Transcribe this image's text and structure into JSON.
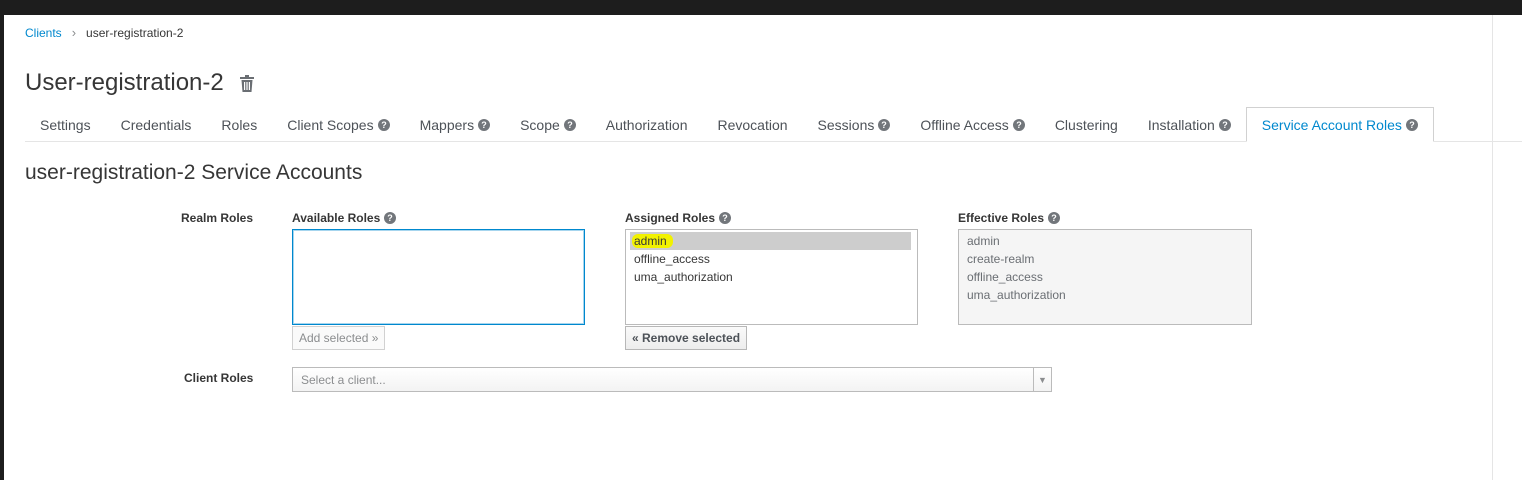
{
  "breadcrumb": {
    "root": "Clients",
    "separator": "›",
    "current": "user-registration-2"
  },
  "page": {
    "title": "User-registration-2",
    "delete_icon": "trash-icon"
  },
  "tabs": [
    {
      "label": "Settings",
      "help": false
    },
    {
      "label": "Credentials",
      "help": false
    },
    {
      "label": "Roles",
      "help": false
    },
    {
      "label": "Client Scopes",
      "help": true
    },
    {
      "label": "Mappers",
      "help": true
    },
    {
      "label": "Scope",
      "help": true
    },
    {
      "label": "Authorization",
      "help": false
    },
    {
      "label": "Revocation",
      "help": false
    },
    {
      "label": "Sessions",
      "help": true
    },
    {
      "label": "Offline Access",
      "help": true
    },
    {
      "label": "Clustering",
      "help": false
    },
    {
      "label": "Installation",
      "help": true
    },
    {
      "label": "Service Account Roles",
      "help": true,
      "active": true
    }
  ],
  "section": {
    "title": "user-registration-2 Service Accounts"
  },
  "realm_roles": {
    "label": "Realm Roles",
    "available": {
      "label": "Available Roles",
      "items": [],
      "button": "Add selected »"
    },
    "assigned": {
      "label": "Assigned Roles",
      "items": [
        "admin",
        "offline_access",
        "uma_authorization"
      ],
      "selected": "admin",
      "button": "« Remove selected"
    },
    "effective": {
      "label": "Effective Roles",
      "items": [
        "admin",
        "create-realm",
        "offline_access",
        "uma_authorization"
      ]
    }
  },
  "client_roles": {
    "label": "Client Roles",
    "placeholder": "Select a client..."
  },
  "colors": {
    "link": "#0088ce",
    "highlight": "#f2f200",
    "selected_bg": "#cdcdcd"
  }
}
